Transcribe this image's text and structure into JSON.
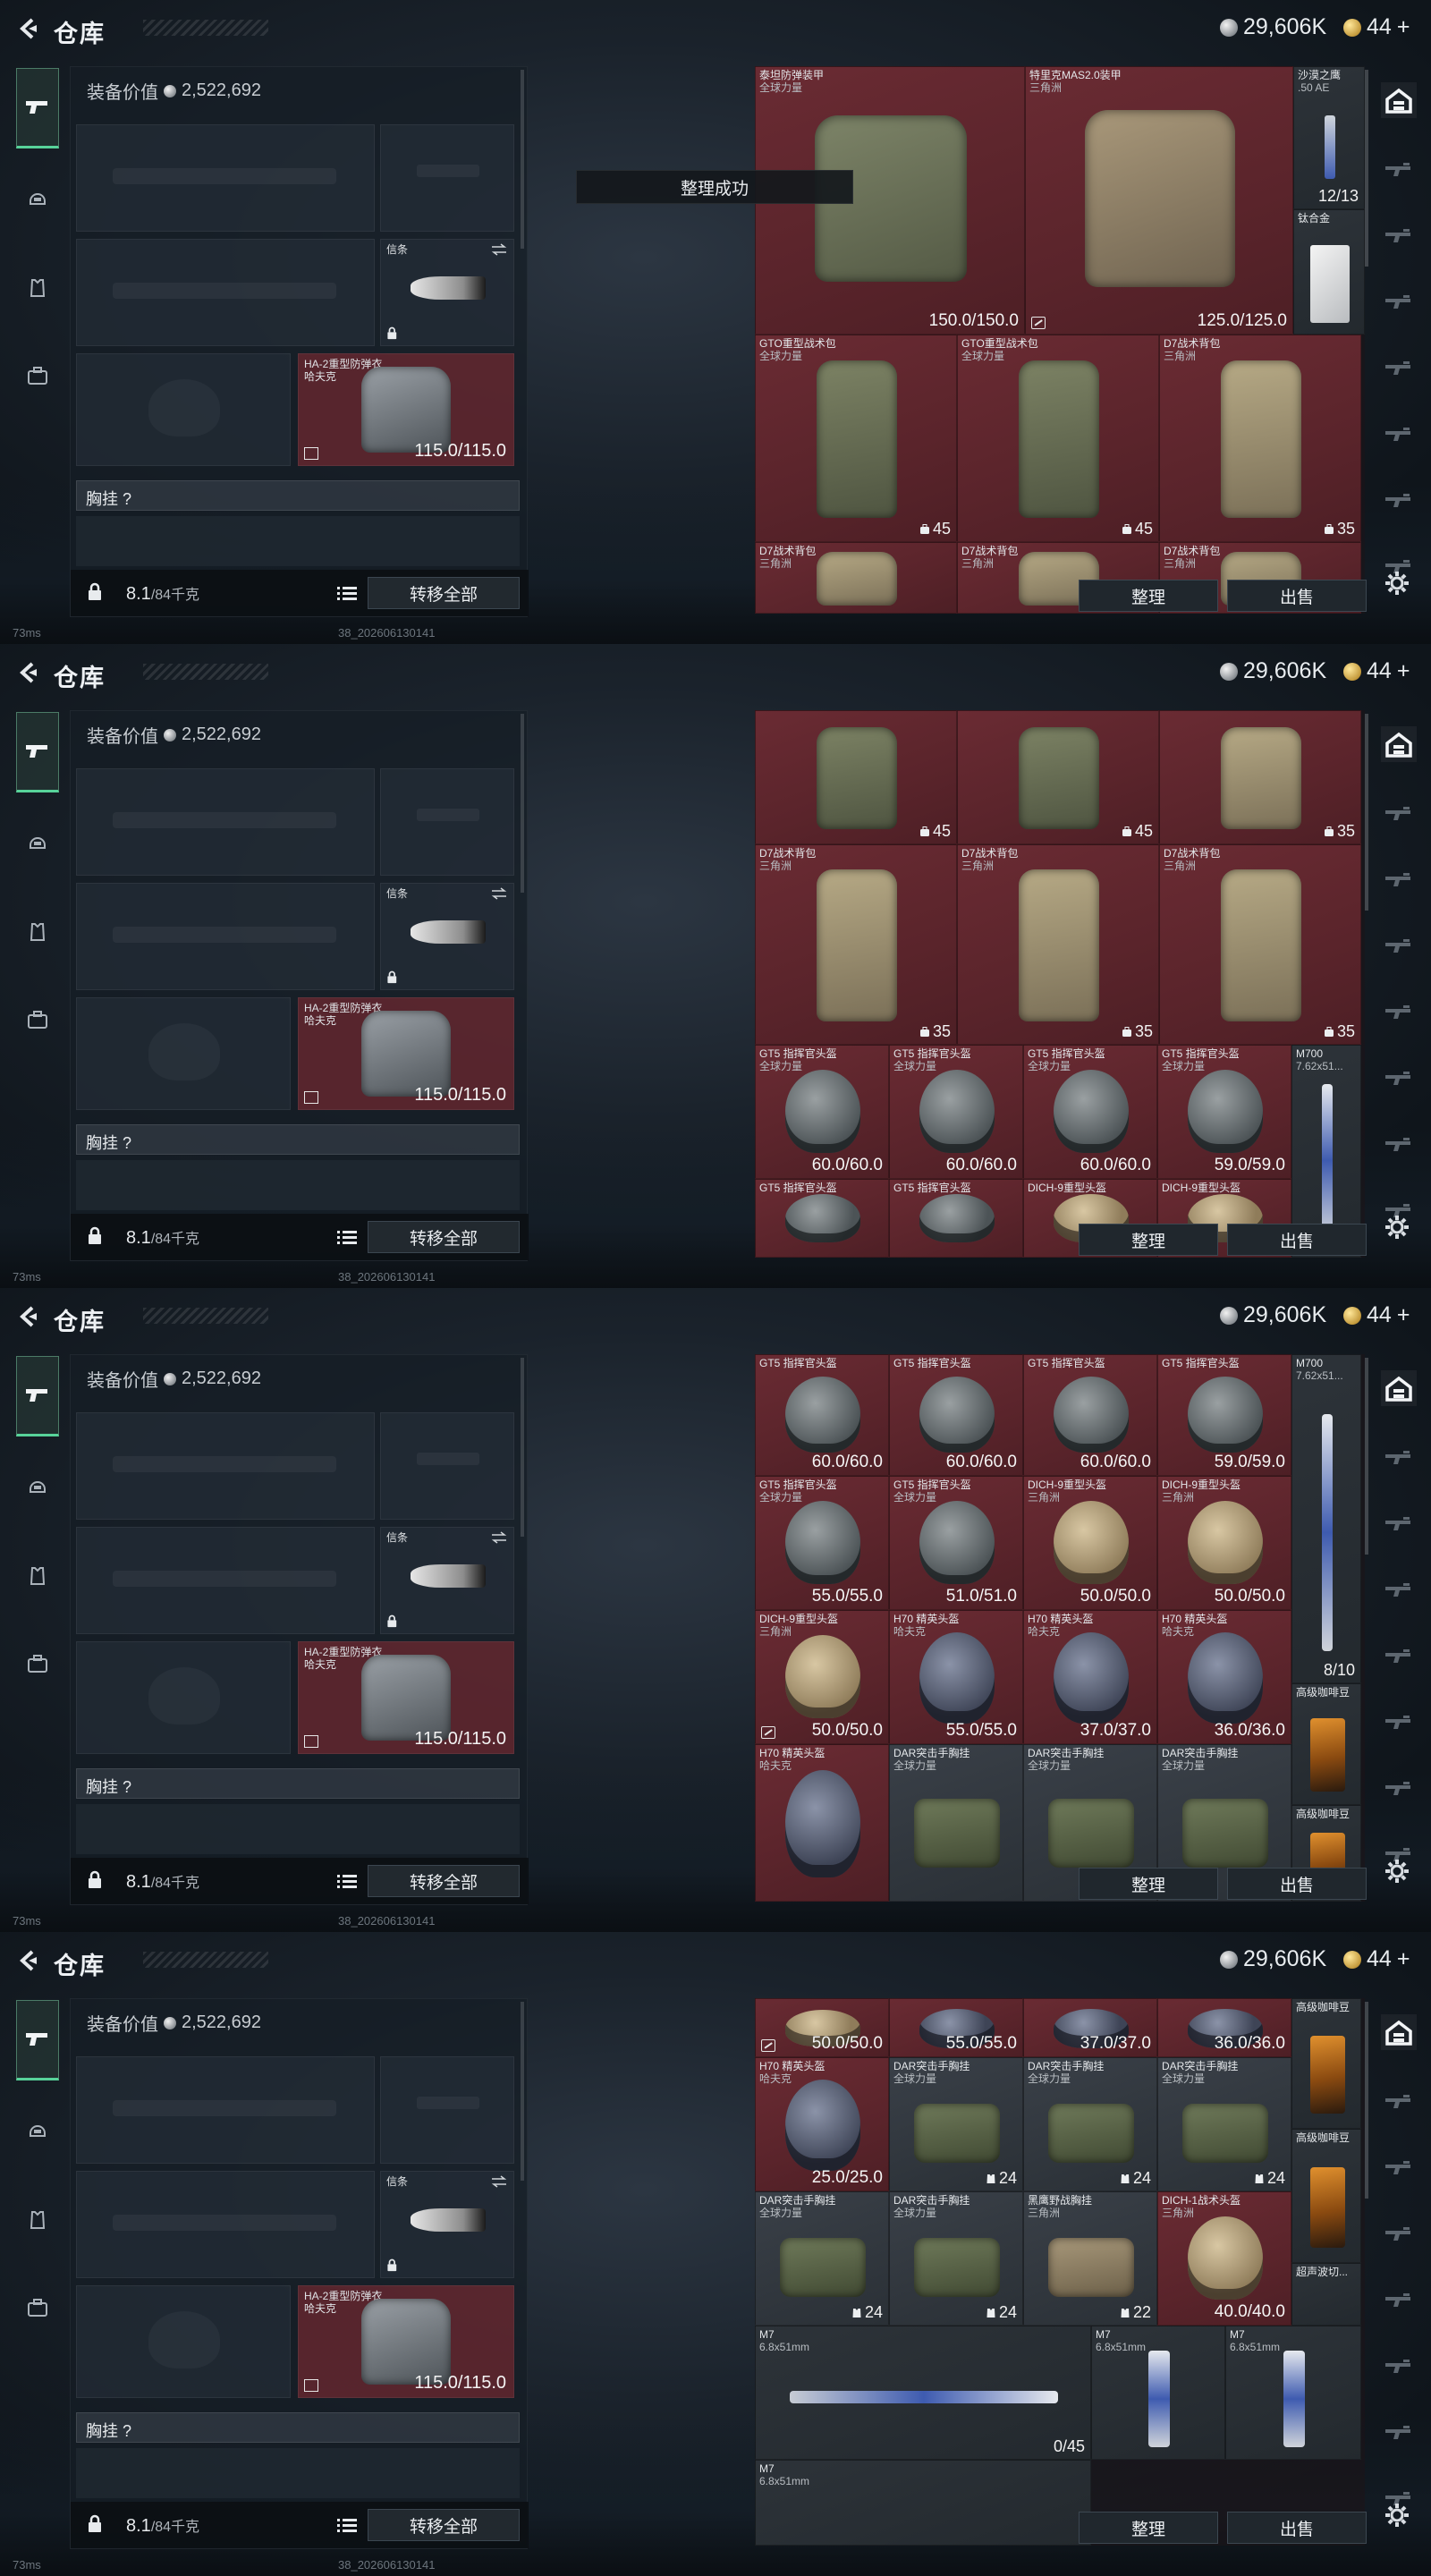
{
  "header": {
    "title": "仓库",
    "silver_amount": "29,606K",
    "gold_amount": "44",
    "gold_plus": "+"
  },
  "loadout": {
    "value_label": "装备价值",
    "value_amount": "2,522,692",
    "tag_label": "信条",
    "armor_name": "HA-2重型防弹衣",
    "armor_sub": "哈夫克",
    "armor_durability": "115.0/115.0",
    "chest_label": "胸挂 ?",
    "weight_value": "8.1",
    "weight_unit": "/84千克",
    "transfer_label": "转移全部"
  },
  "storage": {
    "sort_label": "整理",
    "sell_label": "出售"
  },
  "toast": "整理成功",
  "status": {
    "ping": "73ms",
    "build": "38_202606130141"
  },
  "shot1": {
    "cells": [
      {
        "name": "泰坦防弹装甲",
        "sub": "全球力量",
        "durability": "150.0/150.0"
      },
      {
        "name": "特里克MAS2.0装甲",
        "sub": "三角洲",
        "durability": "125.0/125.0"
      },
      {
        "name": "沙漠之鹰",
        "sub": ".50 AE",
        "count": "12/13"
      },
      {
        "name": "钛合金",
        "sub": ""
      },
      {
        "name": "GTO重型战术包",
        "sub": "全球力量",
        "count": "45"
      },
      {
        "name": "GTO重型战术包",
        "sub": "全球力量",
        "count": "45"
      },
      {
        "name": "D7战术背包",
        "sub": "三角洲",
        "count": "35"
      },
      {
        "name": "D7战术背包",
        "sub": "三角洲"
      },
      {
        "name": "D7战术背包",
        "sub": "三角洲"
      },
      {
        "name": "D7战术背包",
        "sub": "三角洲"
      }
    ]
  },
  "shot2": {
    "cells": [
      {
        "count": "45"
      },
      {
        "count": "45"
      },
      {
        "count": "35"
      },
      {
        "name": "D7战术背包",
        "sub": "三角洲",
        "count": "35"
      },
      {
        "name": "D7战术背包",
        "sub": "三角洲",
        "count": "35"
      },
      {
        "name": "D7战术背包",
        "sub": "三角洲",
        "count": "35"
      },
      {
        "name": "GT5 指挥官头盔",
        "sub": "全球力量",
        "durability": "60.0/60.0"
      },
      {
        "name": "GT5 指挥官头盔",
        "sub": "全球力量",
        "durability": "60.0/60.0"
      },
      {
        "name": "GT5 指挥官头盔",
        "sub": "全球力量",
        "durability": "60.0/60.0"
      },
      {
        "name": "GT5 指挥官头盔",
        "sub": "全球力量",
        "durability": "59.0/59.0"
      },
      {
        "name": "M700",
        "sub": "7.62x51..."
      },
      {
        "name": "GT5 指挥官头盔",
        "sub": ""
      },
      {
        "name": "GT5 指挥官头盔",
        "sub": ""
      },
      {
        "name": "DICH-9重型头盔",
        "sub": ""
      },
      {
        "name": "DICH-9重型头盔",
        "sub": ""
      }
    ]
  },
  "shot3": {
    "cells": [
      {
        "name": "GT5 指挥官头盔",
        "durability": "60.0/60.0"
      },
      {
        "name": "GT5 指挥官头盔",
        "durability": "60.0/60.0"
      },
      {
        "name": "GT5 指挥官头盔",
        "durability": "60.0/60.0"
      },
      {
        "name": "GT5 指挥官头盔",
        "durability": "59.0/59.0"
      },
      {
        "name": "M700",
        "sub": "7.62x51...",
        "count": "8/10"
      },
      {
        "name": "GT5 指挥官头盔",
        "sub": "全球力量",
        "durability": "55.0/55.0"
      },
      {
        "name": "GT5 指挥官头盔",
        "sub": "全球力量",
        "durability": "51.0/51.0"
      },
      {
        "name": "DICH-9重型头盔",
        "sub": "三角洲",
        "durability": "50.0/50.0"
      },
      {
        "name": "DICH-9重型头盔",
        "sub": "三角洲",
        "durability": "50.0/50.0"
      },
      {
        "name": "DICH-9重型头盔",
        "sub": "三角洲",
        "durability": "50.0/50.0"
      },
      {
        "name": "H70 精英头盔",
        "sub": "哈夫克",
        "durability": "55.0/55.0"
      },
      {
        "name": "H70 精英头盔",
        "sub": "哈夫克",
        "durability": "37.0/37.0"
      },
      {
        "name": "H70 精英头盔",
        "sub": "哈夫克",
        "durability": "36.0/36.0"
      },
      {
        "name": "高级咖啡豆",
        "sub": ""
      },
      {
        "name": "H70 精英头盔",
        "sub": "哈夫克"
      },
      {
        "name": "DAR突击手胸挂",
        "sub": "全球力量"
      },
      {
        "name": "DAR突击手胸挂",
        "sub": "全球力量"
      },
      {
        "name": "DAR突击手胸挂",
        "sub": "全球力量"
      },
      {
        "name": "高级咖啡豆",
        "sub": ""
      }
    ]
  },
  "shot4": {
    "cells": [
      {
        "durability": "50.0/50.0"
      },
      {
        "durability": "55.0/55.0"
      },
      {
        "durability": "37.0/37.0"
      },
      {
        "durability": "36.0/36.0"
      },
      {
        "name": "高级咖啡豆",
        "sub": ""
      },
      {
        "name": "H70 精英头盔",
        "sub": "哈夫克",
        "durability": "25.0/25.0"
      },
      {
        "name": "DAR突击手胸挂",
        "sub": "全球力量",
        "count": "24"
      },
      {
        "name": "DAR突击手胸挂",
        "sub": "全球力量",
        "count": "24"
      },
      {
        "name": "DAR突击手胸挂",
        "sub": "全球力量",
        "count": "24"
      },
      {
        "name": "高级咖啡豆",
        "sub": ""
      },
      {
        "name": "DAR突击手胸挂",
        "sub": "全球力量",
        "count": "24"
      },
      {
        "name": "DAR突击手胸挂",
        "sub": "全球力量",
        "count": "24"
      },
      {
        "name": "黑鹰野战胸挂",
        "sub": "三角洲",
        "count": "22"
      },
      {
        "name": "DICH-1战术头盔",
        "sub": "三角洲",
        "durability": "40.0/40.0"
      },
      {
        "name": "超声波切...",
        "sub": ""
      },
      {
        "name": "M7",
        "sub": "6.8x51mm",
        "count": "0/45"
      },
      {
        "name": "M7",
        "sub": "6.8x51mm"
      },
      {
        "name": "M7",
        "sub": "6.8x51mm"
      },
      {
        "name": "M7",
        "sub": "6.8x51mm"
      }
    ]
  },
  "colors": {
    "accent": "#57d39a",
    "item_red": "#6a2b33",
    "panel_dark": "#161e26"
  },
  "icons": [
    "back-arrow-icon",
    "pistol-tab-icon",
    "helmet-tab-icon",
    "vest-tab-icon",
    "backpack-tab-icon",
    "lock-icon",
    "list-icon",
    "swap-icon",
    "broken-icon",
    "backpack-count-icon",
    "chest-count-icon",
    "settings-icon",
    "storage-icon",
    "silver-coin-icon",
    "gold-coin-icon"
  ]
}
